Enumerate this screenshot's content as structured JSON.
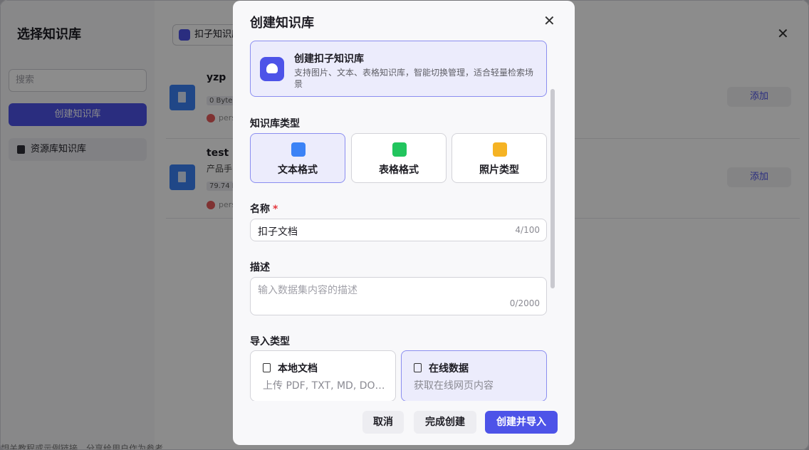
{
  "background": {
    "title": "选择知识库",
    "search_placeholder": "搜索",
    "create_button": "创建知识库",
    "nav_item": "资源库知识库",
    "filter_label": "扣子知识库",
    "items": [
      {
        "name": "yzp",
        "subtitle": "",
        "tag": "0 Byte",
        "owner": "pers",
        "add_label": "添加"
      },
      {
        "name": "test",
        "subtitle": "产品手",
        "tag": "79.74 K",
        "owner": "pers",
        "add_label": "添加"
      }
    ],
    "footer_text": "相关教程或示例链接，分享给用户作为参考"
  },
  "modal": {
    "title": "创建知识库",
    "kind": {
      "name": "创建扣子知识库",
      "description": "支持图片、文本、表格知识库，智能切换管理，适合轻量检索场景"
    },
    "type_label": "知识库类型",
    "types": [
      {
        "label": "文本格式",
        "icon": "text-doc-icon",
        "color": "#3b82f6",
        "selected": true
      },
      {
        "label": "表格格式",
        "icon": "table-icon",
        "color": "#22c55e",
        "selected": false
      },
      {
        "label": "照片类型",
        "icon": "photo-icon",
        "color": "#f5b324",
        "selected": false
      }
    ],
    "name_label": "名称",
    "name_required_mark": "*",
    "name_value": "扣子文档",
    "name_counter": "4/100",
    "desc_label": "描述",
    "desc_placeholder": "输入数据集内容的描述",
    "desc_counter": "0/2000",
    "import_label": "导入类型",
    "imports": [
      {
        "title": "本地文档",
        "description": "上传 PDF, TXT, MD, DOC, DOCX",
        "selected": false
      },
      {
        "title": "在线数据",
        "description": "获取在线网页内容",
        "selected": true
      }
    ],
    "cancel_label": "取消",
    "finish_label": "完成创建",
    "create_import_label": "创建并导入"
  },
  "colors": {
    "accent": "#4d53e8",
    "selected_bg": "#ececfc",
    "required": "#e5393f"
  }
}
